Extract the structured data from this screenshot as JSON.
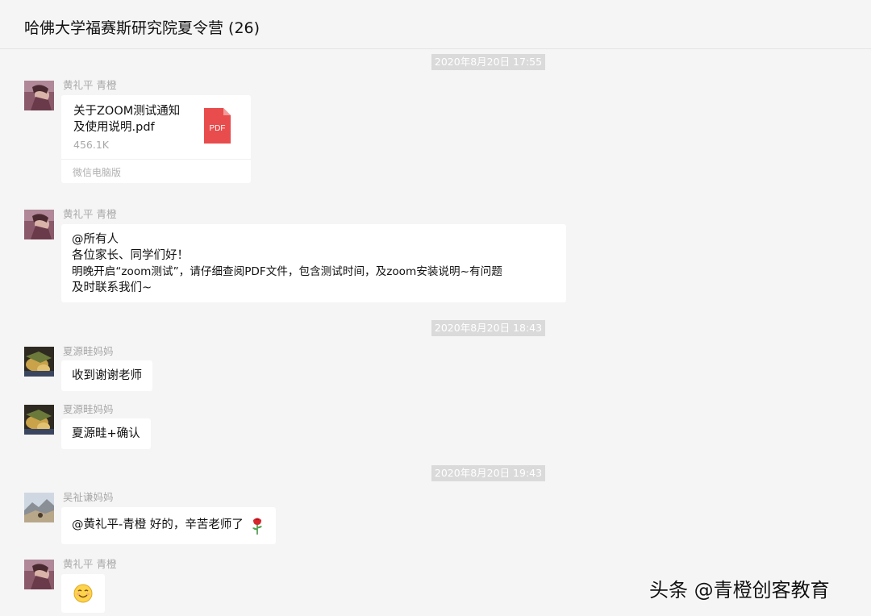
{
  "header": {
    "title": "哈佛大学福赛斯研究院夏令营 (26)"
  },
  "timestamps": [
    "2020年8月20日 17:55",
    "2020年8月20日 18:43",
    "2020年8月20日 19:43"
  ],
  "messages": [
    {
      "sender": "黄礼平  青橙",
      "file": {
        "name_line1": "关于ZOOM测试通知",
        "name_line2": "及使用说明.pdf",
        "size": "456.1K",
        "source": "微信电脑版",
        "icon_label": "PDF"
      }
    },
    {
      "sender": "黄礼平  青橙",
      "lines": [
        "@所有人",
        "各位家长、同学们好！",
        "明晚开启“zoom测试”，请仔细查阅PDF文件，包含测试时间，及zoom安装说明~有问题",
        "及时联系我们~"
      ]
    },
    {
      "sender": "夏源畦妈妈",
      "text": "收到谢谢老师"
    },
    {
      "sender": "夏源畦妈妈",
      "text": "夏源畦+确认"
    },
    {
      "sender": "吴祉谦妈妈",
      "text": "@黄礼平-青橙 好的，辛苦老师了"
    },
    {
      "sender": "黄礼平  青橙",
      "emoji": "smile-emoji"
    }
  ],
  "watermark": "头条 @青橙创客教育",
  "colors": {
    "background": "#f5f5f5",
    "bubble": "#ffffff",
    "timestamp_bg": "#dadada",
    "pdf_red": "#e84c4c"
  }
}
